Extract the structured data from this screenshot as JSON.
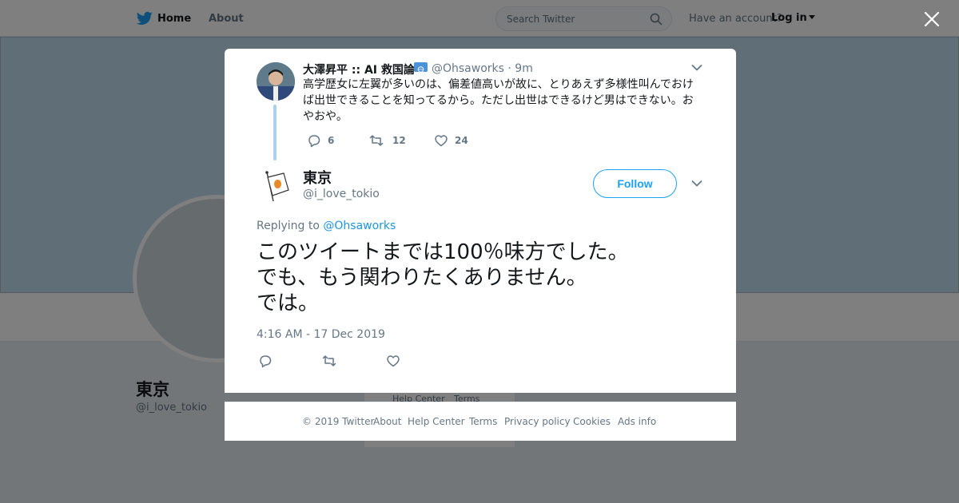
{
  "nav": {
    "home": "Home",
    "about": "About",
    "search_placeholder": "Search Twitter",
    "have_account": "Have an account?",
    "login": "Log in"
  },
  "profile": {
    "name": "東京",
    "handle": "@i_love_tokio"
  },
  "background_links": [
    "Help Center",
    "Terms"
  ],
  "parent_tweet": {
    "author_name": "大澤昇平 :: AI 救国論",
    "handle": "@Ohsaworks",
    "time": "· 9m",
    "text": "高学歴女に左翼が多いのは、偏差値高いが故に、とりあえず多様性叫んでおけば出世できることを知ってるから。ただし出世はできるけど男はできない。おやおや。",
    "replies": "6",
    "retweets": "12",
    "likes": "24"
  },
  "tweet": {
    "author_name": "東京",
    "handle": "@i_love_tokio",
    "follow_label": "Follow",
    "replying_prefix": "Replying to ",
    "replying_to": "@Ohsaworks",
    "text_lines": [
      "このツイートまでは100％味方でした。",
      "でも、もう関わりたくありません。",
      "では。"
    ],
    "timestamp": "4:16 AM - 17 Dec 2019"
  },
  "footer": {
    "copyright": "© 2019 Twitter",
    "about": "About",
    "help": "Help Center",
    "terms": "Terms",
    "privacy": "Privacy policy",
    "cookies": "Cookies",
    "ads": "Ads info"
  },
  "colors": {
    "accent": "#1da1f2",
    "link": "#1b95e0",
    "muted": "#657786",
    "overlay": "rgba(0,0,0,0.5)"
  },
  "icons": [
    "twitter-bird-icon",
    "search-icon",
    "close-icon",
    "chevron-down-icon",
    "reply-icon",
    "retweet-icon",
    "like-icon",
    "flag-icon"
  ]
}
